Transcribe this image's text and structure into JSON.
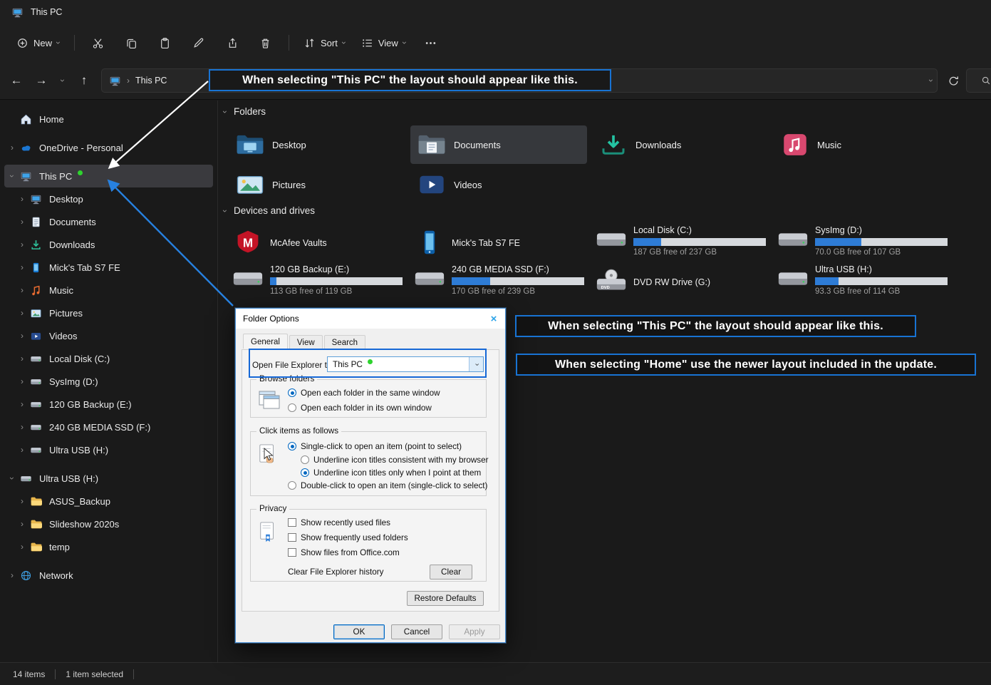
{
  "window": {
    "title": "This PC"
  },
  "toolbar": {
    "new": "New",
    "sort": "Sort",
    "view": "View"
  },
  "navbar": {
    "breadcrumb_root": "This PC"
  },
  "statusbar": {
    "count": "14 items",
    "selected": "1 item selected"
  },
  "annotations": {
    "address_note": "When selecting \"This PC\" the layout should appear like this.",
    "this_pc_note": "When selecting \"This PC\" the layout should appear like this.",
    "home_note": "When selecting \"Home\" use the newer layout included in the update."
  },
  "sidebar": {
    "items": [
      {
        "label": "Home"
      },
      {
        "label": "OneDrive - Personal"
      },
      {
        "label": "This PC"
      },
      {
        "label": "Desktop"
      },
      {
        "label": "Documents"
      },
      {
        "label": "Downloads"
      },
      {
        "label": "Mick's Tab S7 FE"
      },
      {
        "label": "Music"
      },
      {
        "label": "Pictures"
      },
      {
        "label": "Videos"
      },
      {
        "label": "Local Disk (C:)"
      },
      {
        "label": "SysImg (D:)"
      },
      {
        "label": "120 GB Backup (E:)"
      },
      {
        "label": "240 GB MEDIA SSD (F:)"
      },
      {
        "label": "Ultra USB (H:)"
      },
      {
        "label": "Ultra USB (H:)"
      },
      {
        "label": "ASUS_Backup"
      },
      {
        "label": "Slideshow 2020s"
      },
      {
        "label": "temp"
      },
      {
        "label": "Network"
      }
    ]
  },
  "content": {
    "folders": {
      "title": "Folders",
      "items": [
        {
          "label": "Desktop"
        },
        {
          "label": "Documents",
          "selected": true
        },
        {
          "label": "Downloads"
        },
        {
          "label": "Music"
        },
        {
          "label": "Pictures"
        },
        {
          "label": "Videos"
        }
      ]
    },
    "devices": {
      "title": "Devices and drives",
      "items": [
        {
          "label": "McAfee Vaults"
        },
        {
          "label": "Mick's Tab S7 FE"
        },
        {
          "label": "Local Disk (C:)",
          "free": "187 GB free of 237 GB",
          "used_pct": 21
        },
        {
          "label": "SysImg (D:)",
          "free": "70.0 GB free of 107 GB",
          "used_pct": 35
        },
        {
          "label": "120 GB Backup (E:)",
          "free": "113 GB free of 119 GB",
          "used_pct": 5
        },
        {
          "label": "240 GB MEDIA SSD (F:)",
          "free": "170 GB free of 239 GB",
          "used_pct": 29
        },
        {
          "label": "DVD RW Drive (G:)"
        },
        {
          "label": "Ultra USB (H:)",
          "free": "93.3 GB free of 114 GB",
          "used_pct": 18
        }
      ]
    }
  },
  "dialog": {
    "title": "Folder Options",
    "tabs": [
      {
        "label": "General"
      },
      {
        "label": "View"
      },
      {
        "label": "Search"
      }
    ],
    "open_label": "Open File Explorer to:",
    "open_value": "This PC",
    "groups": {
      "browse": {
        "title": "Browse folders",
        "options": [
          {
            "label": "Open each folder in the same window",
            "selected": true
          },
          {
            "label": "Open each folder in its own window",
            "selected": false
          }
        ]
      },
      "click": {
        "title": "Click items as follows",
        "options": [
          {
            "label": "Single-click to open an item (point to select)",
            "selected": true
          },
          {
            "label": "Underline icon titles consistent with my browser",
            "selected": false
          },
          {
            "label": "Underline icon titles only when I point at them",
            "selected": true
          },
          {
            "label": "Double-click to open an item (single-click to select)",
            "selected": false
          }
        ]
      },
      "privacy": {
        "title": "Privacy",
        "options": [
          {
            "label": "Show recently used files",
            "checked": false
          },
          {
            "label": "Show frequently used folders",
            "checked": false
          },
          {
            "label": "Show files from Office.com",
            "checked": false
          }
        ],
        "clear_label": "Clear File Explorer history",
        "clear_button": "Clear"
      }
    },
    "restore_button": "Restore Defaults",
    "ok": "OK",
    "cancel": "Cancel",
    "apply": "Apply"
  },
  "colors": {
    "accent_blue": "#2e7cd6",
    "annotation_blue": "#1873d3",
    "green_dot": "#2ed32e",
    "mcafee_red": "#c41426"
  }
}
